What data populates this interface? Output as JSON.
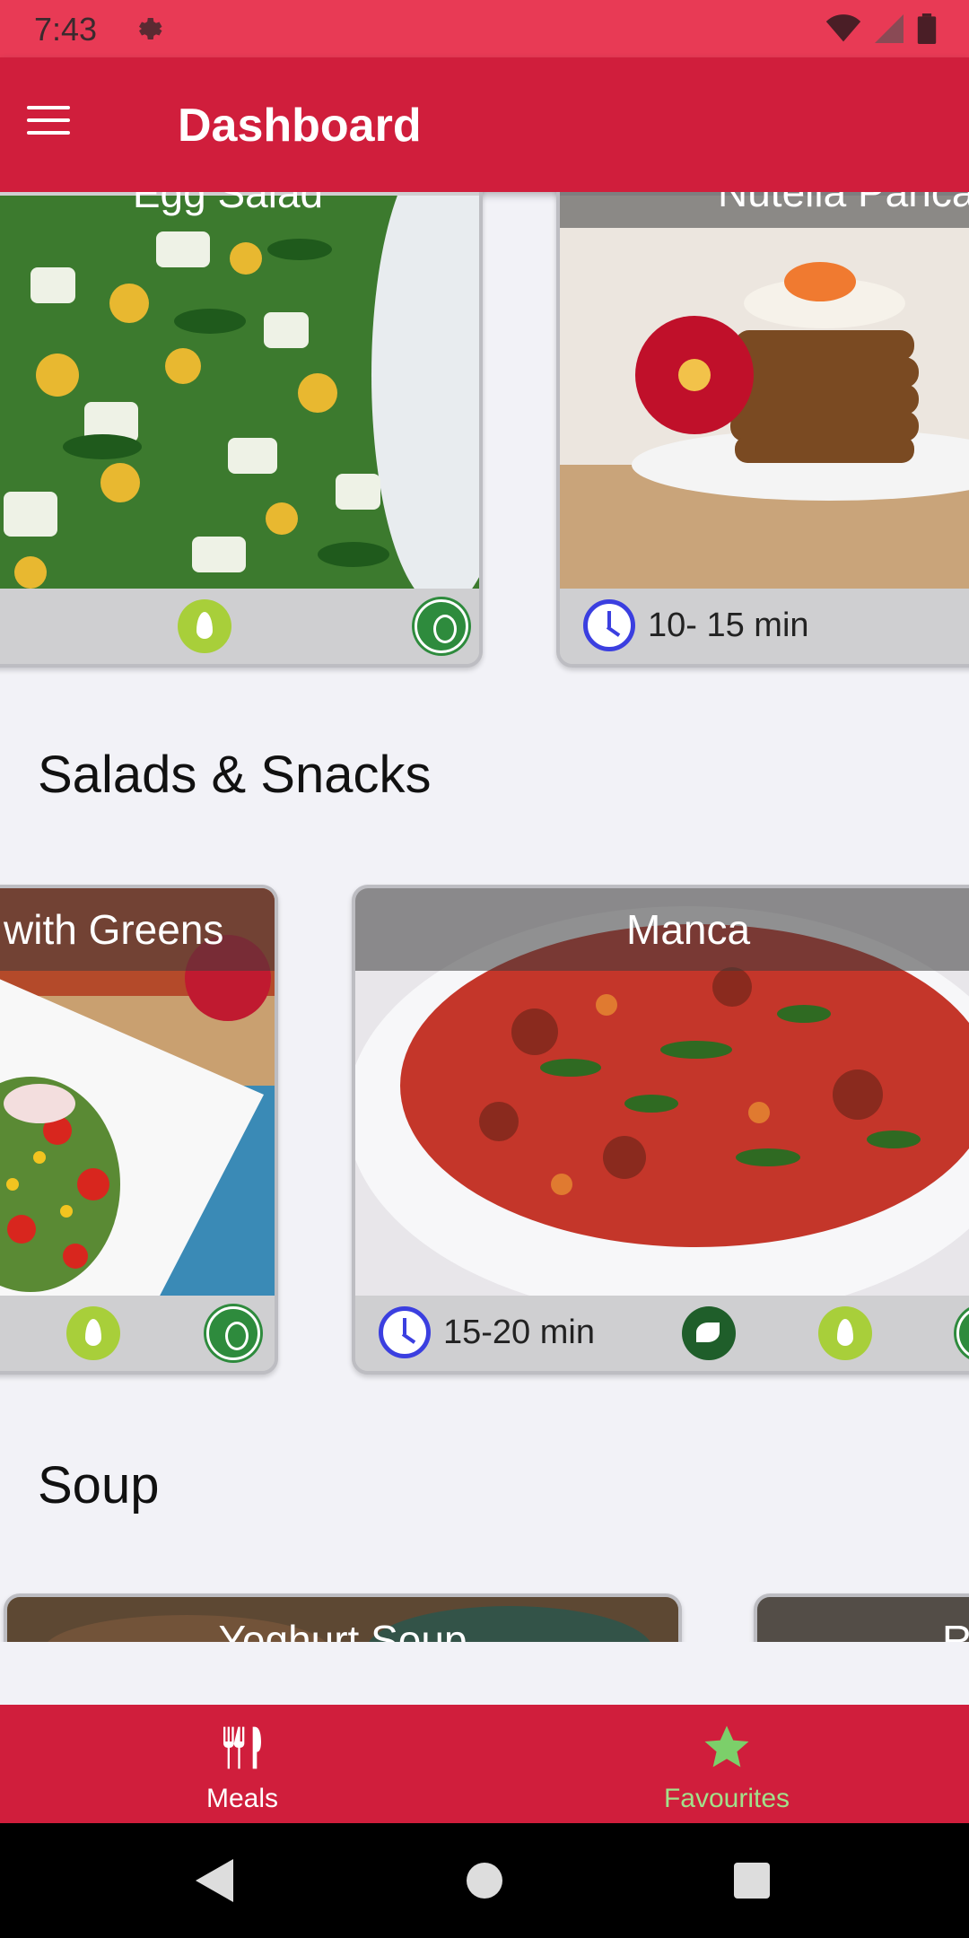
{
  "status_bar": {
    "time": "7:43"
  },
  "app_bar": {
    "title": "Dashboard"
  },
  "sections": [
    {
      "cards": [
        {
          "title": "Egg Salad",
          "time": ""
        },
        {
          "title": "Nutella Pancakes",
          "time": "10- 15 min"
        }
      ]
    },
    {
      "title": "Salads & Snacks",
      "cards": [
        {
          "title": "with Greens",
          "time": ""
        },
        {
          "title": "Manca",
          "time": "15-20 min"
        }
      ]
    },
    {
      "title": "Soup",
      "cards": [
        {
          "title": "Yoghurt Soup"
        },
        {
          "title": "R"
        }
      ]
    }
  ],
  "bottom_nav": {
    "meals_label": "Meals",
    "favourites_label": "Favourites"
  },
  "colors": {
    "status_bar": "#e83a55",
    "primary": "#d01e3c",
    "clock": "#3b3fe0",
    "favourites_accent": "#a2e08a"
  }
}
